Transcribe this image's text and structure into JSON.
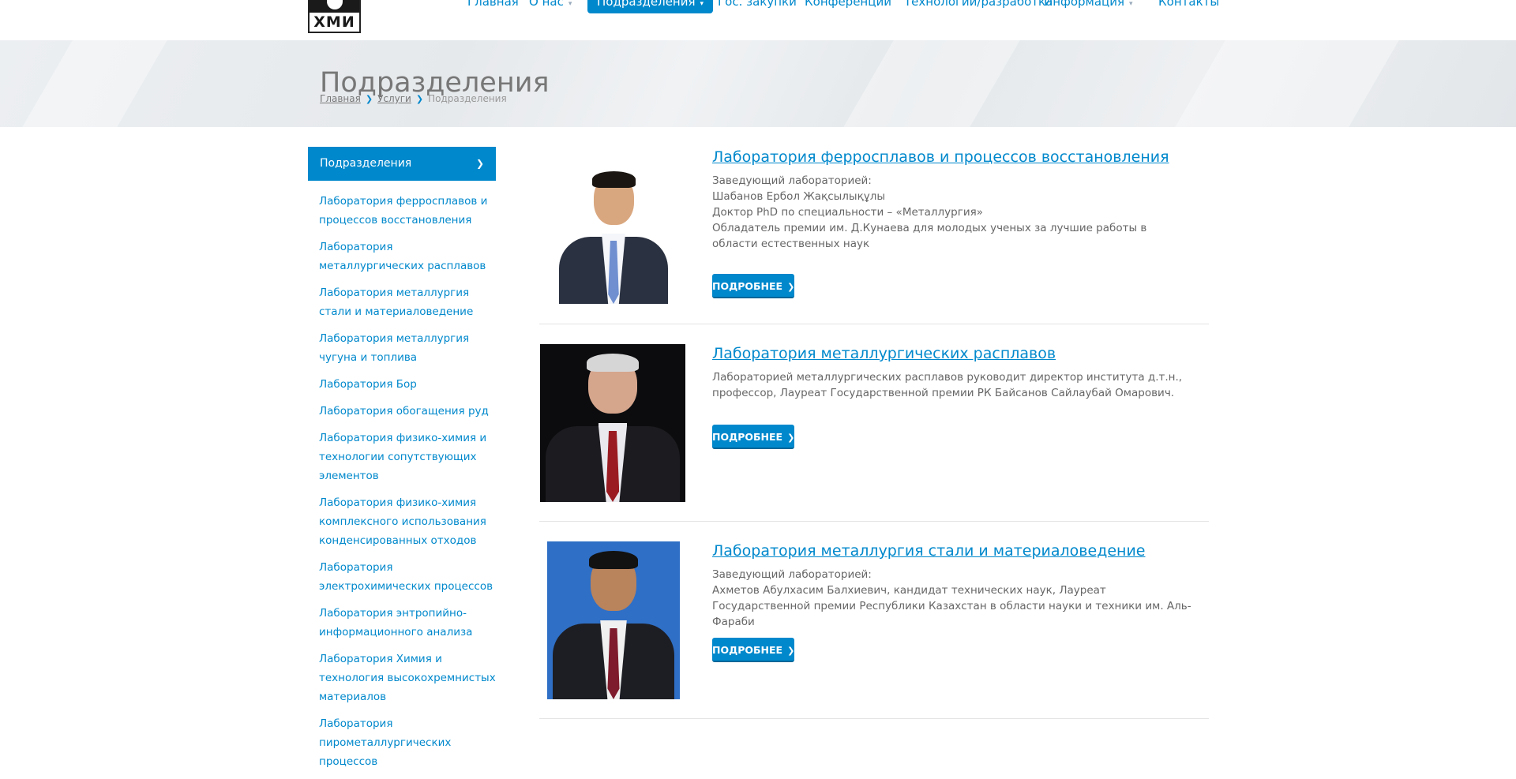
{
  "logo": {
    "text": "ХМИ"
  },
  "nav": [
    {
      "label": "Главная",
      "left": 0,
      "dropdown": false,
      "active": false
    },
    {
      "label": "О нас",
      "dropdown": true,
      "active": false
    },
    {
      "label": "Подразделения",
      "dropdown": true,
      "active": true
    },
    {
      "label": "Гос. закупки",
      "dropdown": false,
      "active": false
    },
    {
      "label": "Конференции",
      "dropdown": false,
      "active": false
    },
    {
      "label": "Технологии/разработка",
      "dropdown": false,
      "active": false
    },
    {
      "label": "Информация",
      "dropdown": true,
      "active": false
    },
    {
      "label": "Контакты",
      "dropdown": false,
      "active": false
    }
  ],
  "page": {
    "title": "Подразделения",
    "breadcrumb": [
      "Главная",
      "Услуги",
      "Подразделения"
    ]
  },
  "sidebar": {
    "heading": "Подразделения",
    "items": [
      "Лаборатория ферросплавов и процессов восстановления",
      "Лаборатория металлургических расплавов",
      "Лаборатория металлургия стали и материаловедение",
      "Лаборатория металлургия чугуна и топлива",
      "Лаборатория Бор",
      "Лаборатория обогащения руд",
      "Лаборатория физико-химия и технологии сопутствующих элементов",
      "Лаборатория физико-химия комплексного использования конденсированных отходов",
      "Лаборатория электрохимических процессов",
      "Лаборатория энтропийно-информационного анализа",
      "Лаборатория Химия и технология высокохремнистых материалов",
      "Лаборатория пирометаллургических процессов"
    ]
  },
  "labs": [
    {
      "title": "Лаборатория ферросплавов и процессов восстановления",
      "lines": [
        "Заведующий лабораторией:",
        "Шабанов Ербол Жақсылықұлы",
        "Доктор PhD по специальности – «Металлургия»",
        "Обладатель премии им. Д.Кунаева для молодых ученых за лучшие работы в области естественных наук"
      ],
      "button": "ПОДРОБНЕЕ",
      "colors": {
        "bg": "#ffffff",
        "suit": "#2a3140",
        "shirt": "#f4f6fa",
        "tie": "#6f8fd0",
        "skin": "#d9a77f",
        "hair": "#1b1612"
      }
    },
    {
      "title": "Лаборатория металлургических расплавов",
      "lines": [
        "Лабораторией металлургических расплавов руководит директор института д.т.н., профессор, Лауреат Государственной премии РК Байсанов Сайлаубай Омарович."
      ],
      "button": "ПОДРОБНЕЕ",
      "colors": {
        "bg": "#0c0c0e",
        "suit": "#1c1c20",
        "shirt": "#e9e9ee",
        "tie": "#9a1c22",
        "skin": "#d5a58c",
        "hair": "#d6d6d6"
      }
    },
    {
      "title": "Лаборатория металлургия стали и материаловедение",
      "lines": [
        "Заведующий лабораторией:",
        "Ахметов Абулхасим Балхиевич, кандидат технических наук, Лауреат Государственной премии Республики Казахстан в области науки и техники им. Аль-Фараби"
      ],
      "button": "ПОДРОБНЕЕ",
      "colors": {
        "bg": "#2f6fc6",
        "suit": "#1d1e24",
        "shirt": "#f0f0f0",
        "tie": "#7e1b2c",
        "skin": "#b9835c",
        "hair": "#121212"
      }
    }
  ]
}
